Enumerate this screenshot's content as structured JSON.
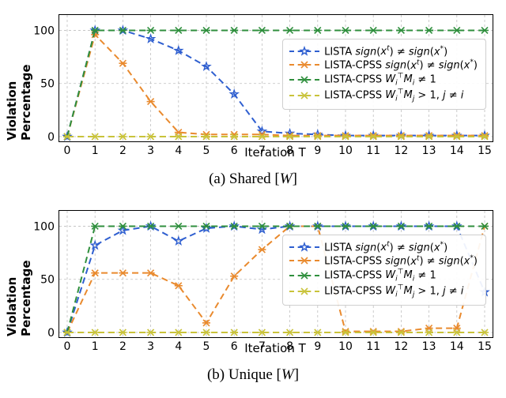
{
  "chart_data": [
    {
      "id": "a",
      "type": "line",
      "title_caption": "(a) Shared [W]",
      "xlabel": "Iteration T",
      "ylabel": "Violation Percentage",
      "xlim": [
        0,
        15
      ],
      "ylim": [
        0,
        110
      ],
      "xticks": [
        0,
        1,
        2,
        3,
        4,
        5,
        6,
        7,
        8,
        9,
        10,
        11,
        12,
        13,
        14,
        15
      ],
      "yticks": [
        0,
        50,
        100
      ],
      "x": [
        0,
        1,
        2,
        3,
        4,
        5,
        6,
        7,
        8,
        9,
        10,
        11,
        12,
        13,
        14,
        15
      ],
      "series": [
        {
          "name": "LISTA sign(x^t) ≠ sign(x*)",
          "color": "#2f5fd0",
          "marker": "star",
          "values": [
            0,
            100,
            100,
            92,
            81,
            66,
            40,
            5,
            3,
            2,
            1,
            1,
            1,
            1,
            1,
            1
          ]
        },
        {
          "name": "LISTA-CPSS sign(x^t) ≠ sign(x*)",
          "color": "#e98a2e",
          "marker": "xdash",
          "values": [
            0,
            96,
            69,
            33,
            4,
            2,
            2,
            2,
            1,
            1,
            1,
            1,
            1,
            1,
            1,
            1
          ]
        },
        {
          "name": "LISTA-CPSS W_i^T M_i ≠ 1",
          "color": "#2f8f3d",
          "marker": "xdash",
          "values": [
            0,
            100,
            100,
            100,
            100,
            100,
            100,
            100,
            100,
            100,
            100,
            100,
            100,
            100,
            100,
            100
          ]
        },
        {
          "name": "LISTA-CPSS W_i^T M_j > 1, j ≠ i",
          "color": "#c9c33a",
          "marker": "xdash",
          "values": [
            0,
            0,
            0,
            0,
            0,
            0,
            0,
            0,
            0,
            0,
            0,
            0,
            0,
            0,
            0,
            0
          ]
        }
      ],
      "legend_html": [
        "LISTA <span class='it'>sign</span>(<span class='it'>x<span class='sup'>t</span></span>) ≠ <span class='it'>sign</span>(<span class='it'>x</span><span class='sup'>*</span>)",
        "LISTA-CPSS <span class='it'>sign</span>(<span class='it'>x<span class='sup'>t</span></span>) ≠ <span class='it'>sign</span>(<span class='it'>x</span><span class='sup'>*</span>)",
        "LISTA-CPSS <span class='it'>W<span class='sub'>i</span><span class='sup'>⊤</span>M<span class='sub'>i</span></span> ≠ 1",
        "LISTA-CPSS <span class='it'>W<span class='sub'>i</span><span class='sup'>⊤</span>M<span class='sub'>j</span></span> &gt; 1, <span class='it'>j</span> ≠ <span class='it'>i</span>"
      ]
    },
    {
      "id": "b",
      "type": "line",
      "title_caption": "(b) Unique [W]",
      "xlabel": "Iteration T",
      "ylabel": "Violation Percentage",
      "xlim": [
        0,
        15
      ],
      "ylim": [
        0,
        110
      ],
      "xticks": [
        0,
        1,
        2,
        3,
        4,
        5,
        6,
        7,
        8,
        9,
        10,
        11,
        12,
        13,
        14,
        15
      ],
      "yticks": [
        0,
        50,
        100
      ],
      "x": [
        0,
        1,
        2,
        3,
        4,
        5,
        6,
        7,
        8,
        9,
        10,
        11,
        12,
        13,
        14,
        15
      ],
      "series": [
        {
          "name": "LISTA sign(x^t) ≠ sign(x*)",
          "color": "#2f5fd0",
          "marker": "star",
          "values": [
            0,
            82,
            96,
            100,
            86,
            98,
            100,
            97,
            100,
            100,
            100,
            100,
            100,
            100,
            100,
            38
          ]
        },
        {
          "name": "LISTA-CPSS sign(x^t) ≠ sign(x*)",
          "color": "#e98a2e",
          "marker": "xdash",
          "values": [
            0,
            56,
            56,
            56,
            44,
            9,
            53,
            78,
            100,
            100,
            1,
            1,
            1,
            4,
            4,
            100
          ]
        },
        {
          "name": "LISTA-CPSS W_i^T M_i ≠ 1",
          "color": "#2f8f3d",
          "marker": "xdash",
          "values": [
            0,
            100,
            100,
            100,
            100,
            100,
            100,
            100,
            100,
            100,
            100,
            100,
            100,
            100,
            100,
            100
          ]
        },
        {
          "name": "LISTA-CPSS W_i^T M_j > 1, j ≠ i",
          "color": "#c9c33a",
          "marker": "xdash",
          "values": [
            0,
            0,
            0,
            0,
            0,
            0,
            0,
            0,
            0,
            0,
            0,
            0,
            0,
            0,
            0,
            0
          ]
        }
      ],
      "legend_html": [
        "LISTA <span class='it'>sign</span>(<span class='it'>x<span class='sup'>t</span></span>) ≠ <span class='it'>sign</span>(<span class='it'>x</span><span class='sup'>*</span>)",
        "LISTA-CPSS <span class='it'>sign</span>(<span class='it'>x<span class='sup'>t</span></span>) ≠ <span class='it'>sign</span>(<span class='it'>x</span><span class='sup'>*</span>)",
        "LISTA-CPSS <span class='it'>W<span class='sub'>i</span><span class='sup'>⊤</span>M<span class='sub'>i</span></span> ≠ 1",
        "LISTA-CPSS <span class='it'>W<span class='sub'>i</span><span class='sup'>⊤</span>M<span class='sub'>j</span></span> &gt; 1, <span class='it'>j</span> ≠ <span class='it'>i</span>"
      ]
    }
  ],
  "captions": {
    "a": "(a) Shared [W]",
    "b": "(b) Unique [W]"
  },
  "axis": {
    "x": "Iteration T",
    "y": "Violation Percentage"
  }
}
